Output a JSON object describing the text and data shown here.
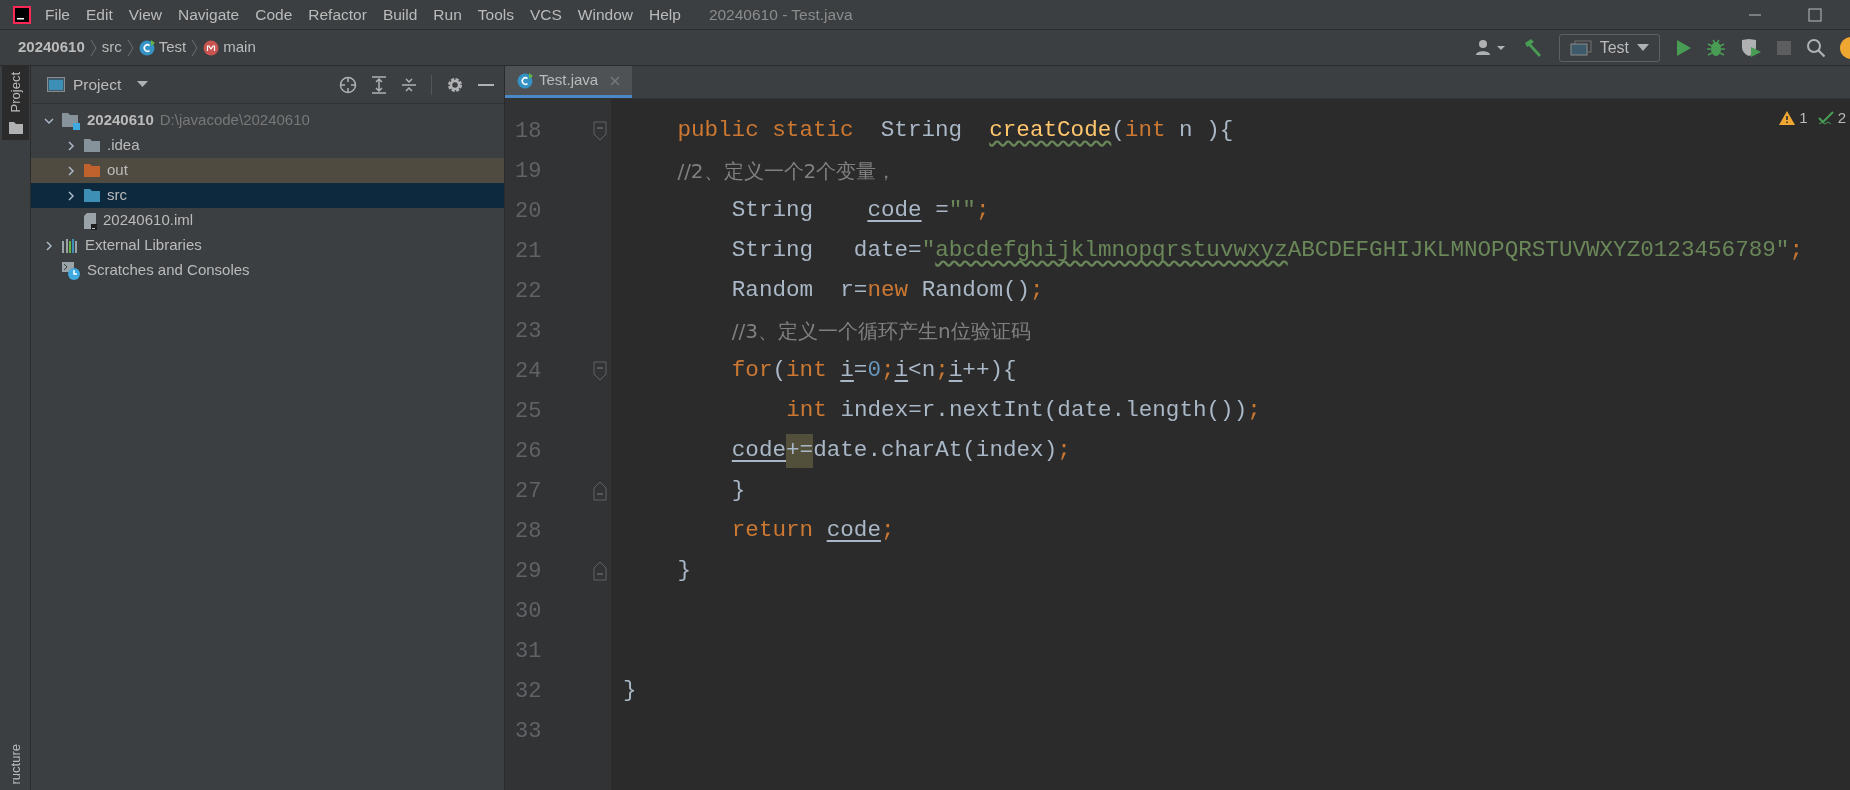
{
  "menu": [
    "File",
    "Edit",
    "View",
    "Navigate",
    "Code",
    "Refactor",
    "Build",
    "Run",
    "Tools",
    "VCS",
    "Window",
    "Help"
  ],
  "window": {
    "title": "20240610 - Test.java"
  },
  "breadcrumb": [
    {
      "kind": "project",
      "label": "20240610"
    },
    {
      "kind": "folder",
      "label": "src"
    },
    {
      "kind": "class",
      "label": "Test"
    },
    {
      "kind": "method",
      "label": "main"
    }
  ],
  "run_config": {
    "label": "Test"
  },
  "toolbar": [
    {
      "kind": "user",
      "disabled": false
    },
    {
      "kind": "build",
      "disabled": false
    },
    {
      "kind": "config",
      "disabled": false
    },
    {
      "kind": "run",
      "disabled": false
    },
    {
      "kind": "debug",
      "disabled": false
    },
    {
      "kind": "coverage",
      "disabled": false
    },
    {
      "kind": "stop",
      "disabled": true
    },
    {
      "kind": "search",
      "disabled": false
    },
    {
      "kind": "update",
      "disabled": false
    }
  ],
  "side_tabs": [
    {
      "label": "Project",
      "selected": true,
      "kind": "top"
    },
    {
      "label": "ructure",
      "selected": false,
      "kind": "bottom"
    }
  ],
  "project_panel": {
    "title": "Project",
    "tree": [
      {
        "kind": "project",
        "label": "20240610",
        "path": "D:\\javacode\\20240610",
        "expanded": true,
        "selected": false,
        "excluded": false,
        "children": [
          {
            "kind": "folder",
            "label": ".idea",
            "color": "#87939a",
            "expanded": false,
            "selected": false,
            "excluded": false
          },
          {
            "kind": "folder",
            "label": "out",
            "color": "#c0622d",
            "expanded": false,
            "selected": false,
            "excluded": true
          },
          {
            "kind": "folder",
            "label": "src",
            "color": "#3d8fb5",
            "expanded": false,
            "selected": true,
            "excluded": false
          },
          {
            "kind": "file",
            "label": "20240610.iml",
            "selected": false,
            "excluded": false
          }
        ]
      },
      {
        "kind": "libraries",
        "label": "External Libraries",
        "expanded": false,
        "selected": false,
        "excluded": false
      },
      {
        "kind": "scratches",
        "label": "Scratches and Consoles",
        "selected": false,
        "excluded": false
      }
    ]
  },
  "editor_tabs": [
    {
      "label": "Test.java",
      "selected": true
    }
  ],
  "inspections": [
    {
      "kind": "warning",
      "count": "1"
    },
    {
      "kind": "ok",
      "count": "2"
    }
  ],
  "lines": [
    {
      "number": "18",
      "kind": "member",
      "fold_start": true,
      "fold_end": false,
      "tokens": [
        {
          "kind": "keyword",
          "text": "public static"
        },
        {
          "kind": "plain",
          "text": "  String  "
        },
        {
          "kind": "method_typo",
          "text": "creatCode"
        },
        {
          "kind": "plain",
          "text": "("
        },
        {
          "kind": "keyword",
          "text": "int"
        },
        {
          "kind": "plain",
          "text": " n ){"
        }
      ]
    },
    {
      "number": "19",
      "kind": "member",
      "fold_start": false,
      "fold_end": false,
      "tokens": [
        {
          "kind": "comment",
          "text": "//2、定义一个2个变量，"
        }
      ]
    },
    {
      "number": "20",
      "kind": "body",
      "fold_start": false,
      "fold_end": false,
      "tokens": [
        {
          "kind": "plain",
          "text": "String    "
        },
        {
          "kind": "reassigned",
          "text": "code"
        },
        {
          "kind": "plain",
          "text": " ="
        },
        {
          "kind": "string",
          "text": "\"\""
        },
        {
          "kind": "keyword",
          "text": ";"
        }
      ]
    },
    {
      "number": "21",
      "kind": "body",
      "fold_start": false,
      "fold_end": false,
      "tokens": [
        {
          "kind": "plain",
          "text": "String   date="
        },
        {
          "kind": "string",
          "text": "\""
        },
        {
          "kind": "string_typo",
          "text": "abcdefghijklmnopqrstuvwxyz"
        },
        {
          "kind": "string",
          "text": "ABCDEFGHIJKLMNOPQRSTUVWXYZ0123456789\""
        },
        {
          "kind": "keyword",
          "text": ";"
        }
      ]
    },
    {
      "number": "22",
      "kind": "body",
      "fold_start": false,
      "fold_end": false,
      "tokens": [
        {
          "kind": "plain",
          "text": "Random  r="
        },
        {
          "kind": "keyword",
          "text": "new"
        },
        {
          "kind": "plain",
          "text": " Random()"
        },
        {
          "kind": "keyword",
          "text": ";"
        }
      ]
    },
    {
      "number": "23",
      "kind": "body",
      "fold_start": false,
      "fold_end": false,
      "tokens": [
        {
          "kind": "comment",
          "text": "//3、定义一个循环产生n位验证码"
        }
      ]
    },
    {
      "number": "24",
      "kind": "body",
      "fold_start": true,
      "fold_end": false,
      "tokens": [
        {
          "kind": "keyword",
          "text": "for"
        },
        {
          "kind": "plain",
          "text": "("
        },
        {
          "kind": "keyword",
          "text": "int "
        },
        {
          "kind": "reassigned",
          "text": "i"
        },
        {
          "kind": "plain",
          "text": "="
        },
        {
          "kind": "number",
          "text": "0"
        },
        {
          "kind": "keyword",
          "text": ";"
        },
        {
          "kind": "reassigned",
          "text": "i"
        },
        {
          "kind": "plain",
          "text": "<n"
        },
        {
          "kind": "keyword",
          "text": ";"
        },
        {
          "kind": "reassigned",
          "text": "i"
        },
        {
          "kind": "plain",
          "text": "++){"
        }
      ]
    },
    {
      "number": "25",
      "kind": "nested",
      "fold_start": false,
      "fold_end": false,
      "tokens": [
        {
          "kind": "keyword",
          "text": "int"
        },
        {
          "kind": "plain",
          "text": " index=r.nextInt(date.length())"
        },
        {
          "kind": "keyword",
          "text": ";"
        }
      ]
    },
    {
      "number": "26",
      "kind": "body",
      "fold_start": false,
      "fold_end": false,
      "tokens": [
        {
          "kind": "reassigned",
          "text": "code"
        },
        {
          "kind": "match",
          "text": "+="
        },
        {
          "kind": "plain",
          "text": "date.charAt(index)"
        },
        {
          "kind": "keyword",
          "text": ";"
        }
      ]
    },
    {
      "number": "27",
      "kind": "body",
      "fold_start": false,
      "fold_end": true,
      "tokens": [
        {
          "kind": "plain",
          "text": "}"
        }
      ]
    },
    {
      "number": "28",
      "kind": "body",
      "fold_start": false,
      "fold_end": false,
      "tokens": [
        {
          "kind": "keyword",
          "text": "return "
        },
        {
          "kind": "reassigned",
          "text": "code"
        },
        {
          "kind": "keyword",
          "text": ";"
        }
      ]
    },
    {
      "number": "29",
      "kind": "member",
      "fold_start": false,
      "fold_end": true,
      "tokens": [
        {
          "kind": "plain",
          "text": "}"
        }
      ]
    },
    {
      "number": "30",
      "fold_start": false,
      "fold_end": false
    },
    {
      "number": "31",
      "fold_start": false,
      "fold_end": false
    },
    {
      "number": "32",
      "kind": "class",
      "fold_start": false,
      "fold_end": false,
      "tokens": [
        {
          "kind": "plain",
          "text": "}"
        }
      ]
    },
    {
      "number": "33",
      "fold_start": false,
      "fold_end": false
    }
  ]
}
